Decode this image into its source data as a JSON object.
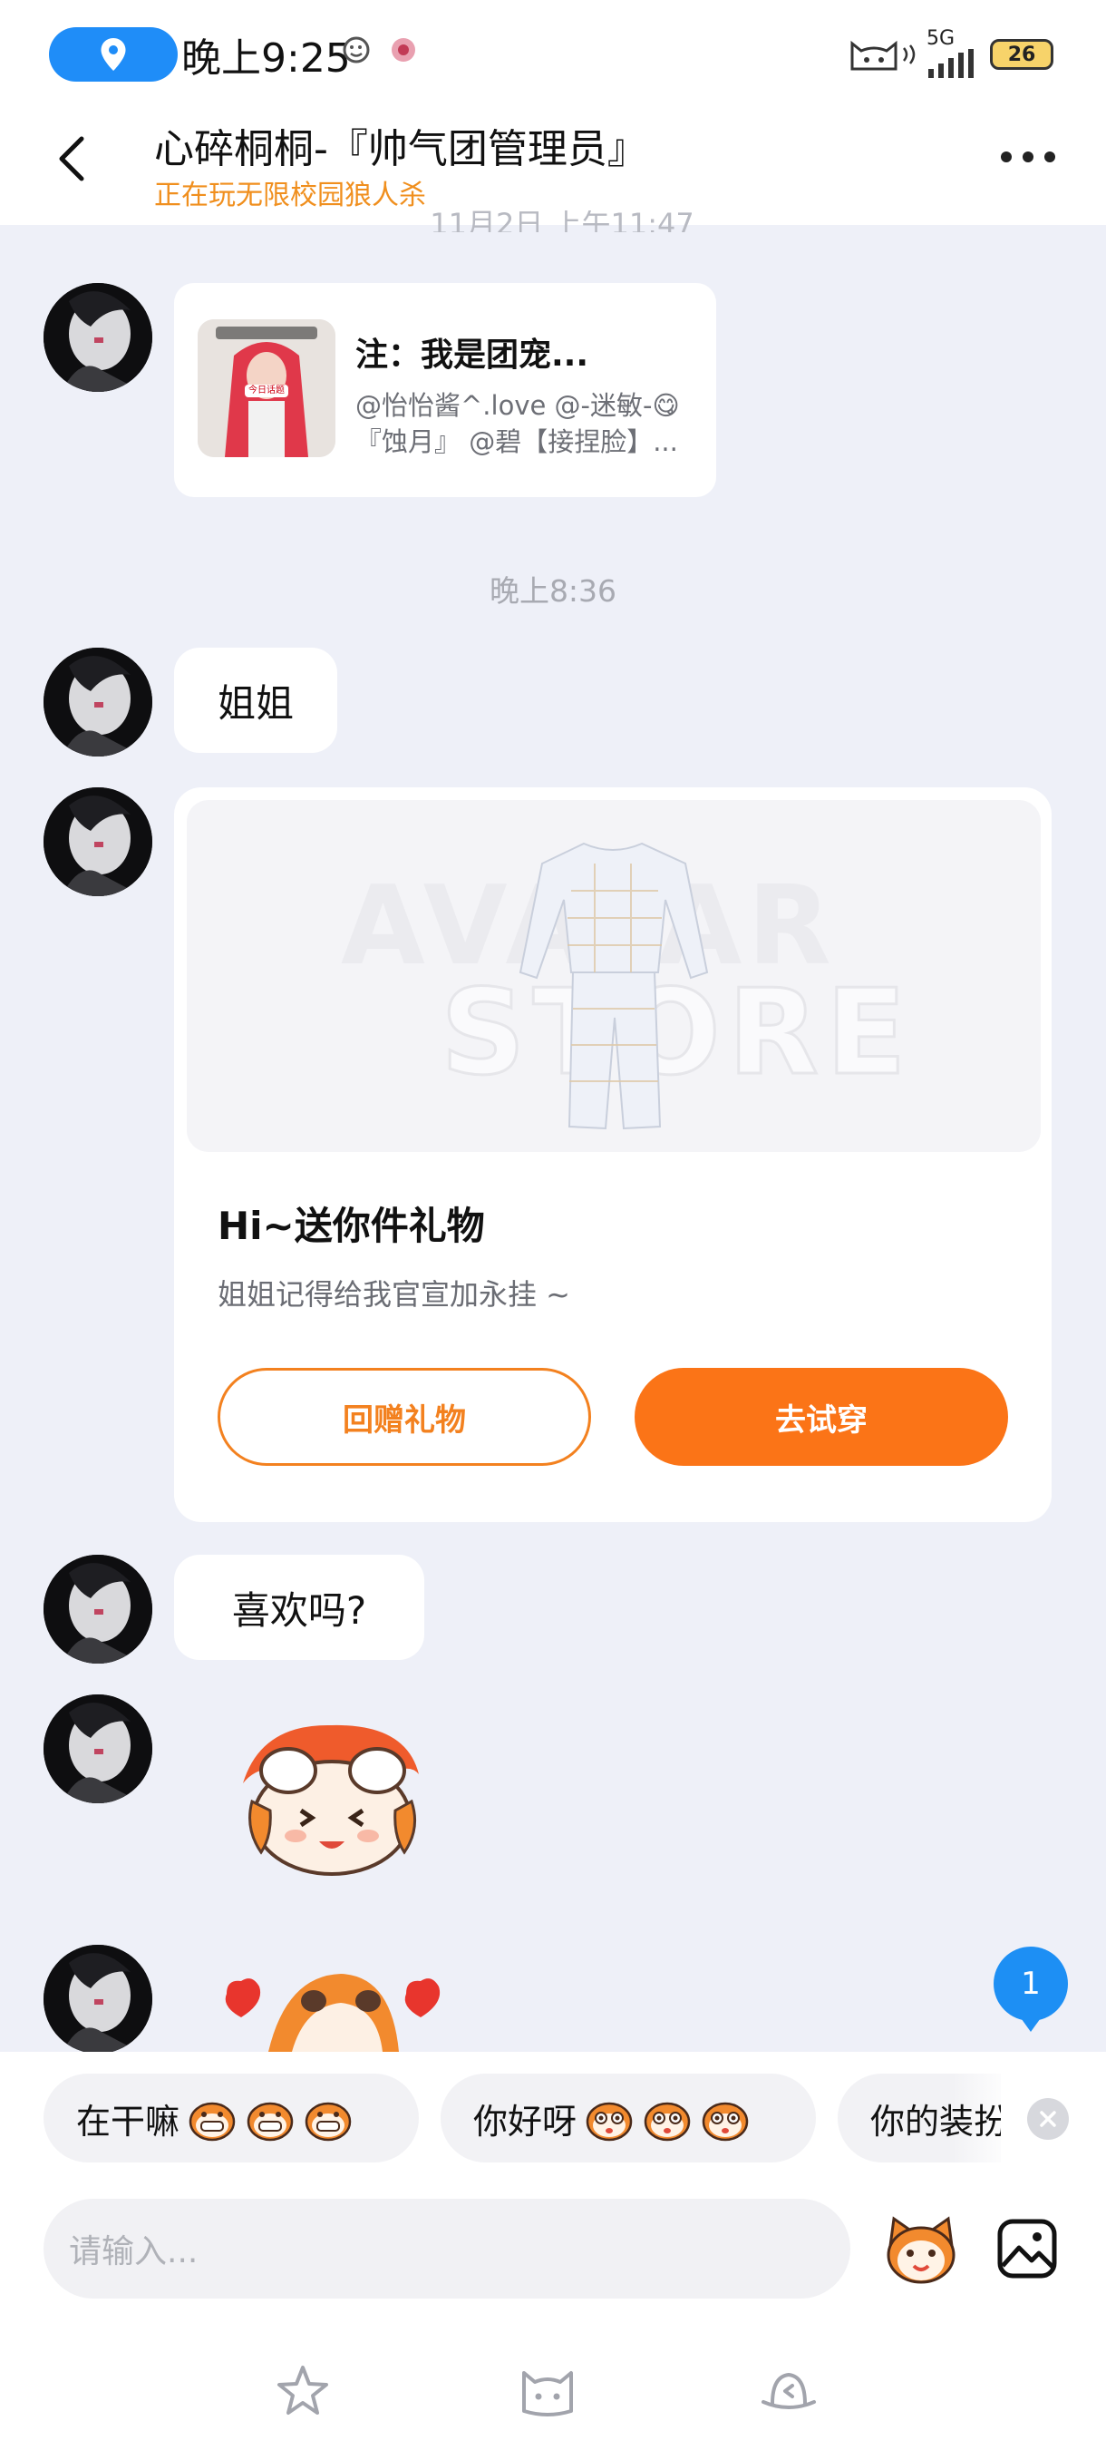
{
  "status_bar": {
    "time": "晚上9:25",
    "network": "5G",
    "battery": "26"
  },
  "header": {
    "title": "心碎桐桐-『帅气团管理员』",
    "subtitle": "正在玩无限校园狼人杀"
  },
  "messages": {
    "clipped_timestamp": "11月2日 上午11:47",
    "share_card": {
      "thumb_caption": "今日话题",
      "title": "注：我是团宠...",
      "line1": "@怡怡酱^.love  @-迷敏-😋",
      "line2": "『蚀月』 @碧【接捏脸】..."
    },
    "timestamp": "晚上8:36",
    "text1": "姐姐",
    "gift": {
      "watermark1": "AVATAR",
      "watermark2": "STORE",
      "title": "Hi~送你件礼物",
      "desc": "姐姐记得给我官宣加永挂 ~",
      "btn_return": "回赠礼物",
      "btn_try": "去试穿"
    },
    "text2": "喜欢吗?"
  },
  "unread_badge": "1",
  "quick_replies": [
    {
      "label": "在干嘛"
    },
    {
      "label": "你好呀"
    },
    {
      "label": "你的装扮"
    }
  ],
  "composer": {
    "placeholder": "请输入..."
  },
  "colors": {
    "accent": "#fb7417",
    "blue": "#1d8ff4",
    "subtitle": "#f08f1e"
  }
}
